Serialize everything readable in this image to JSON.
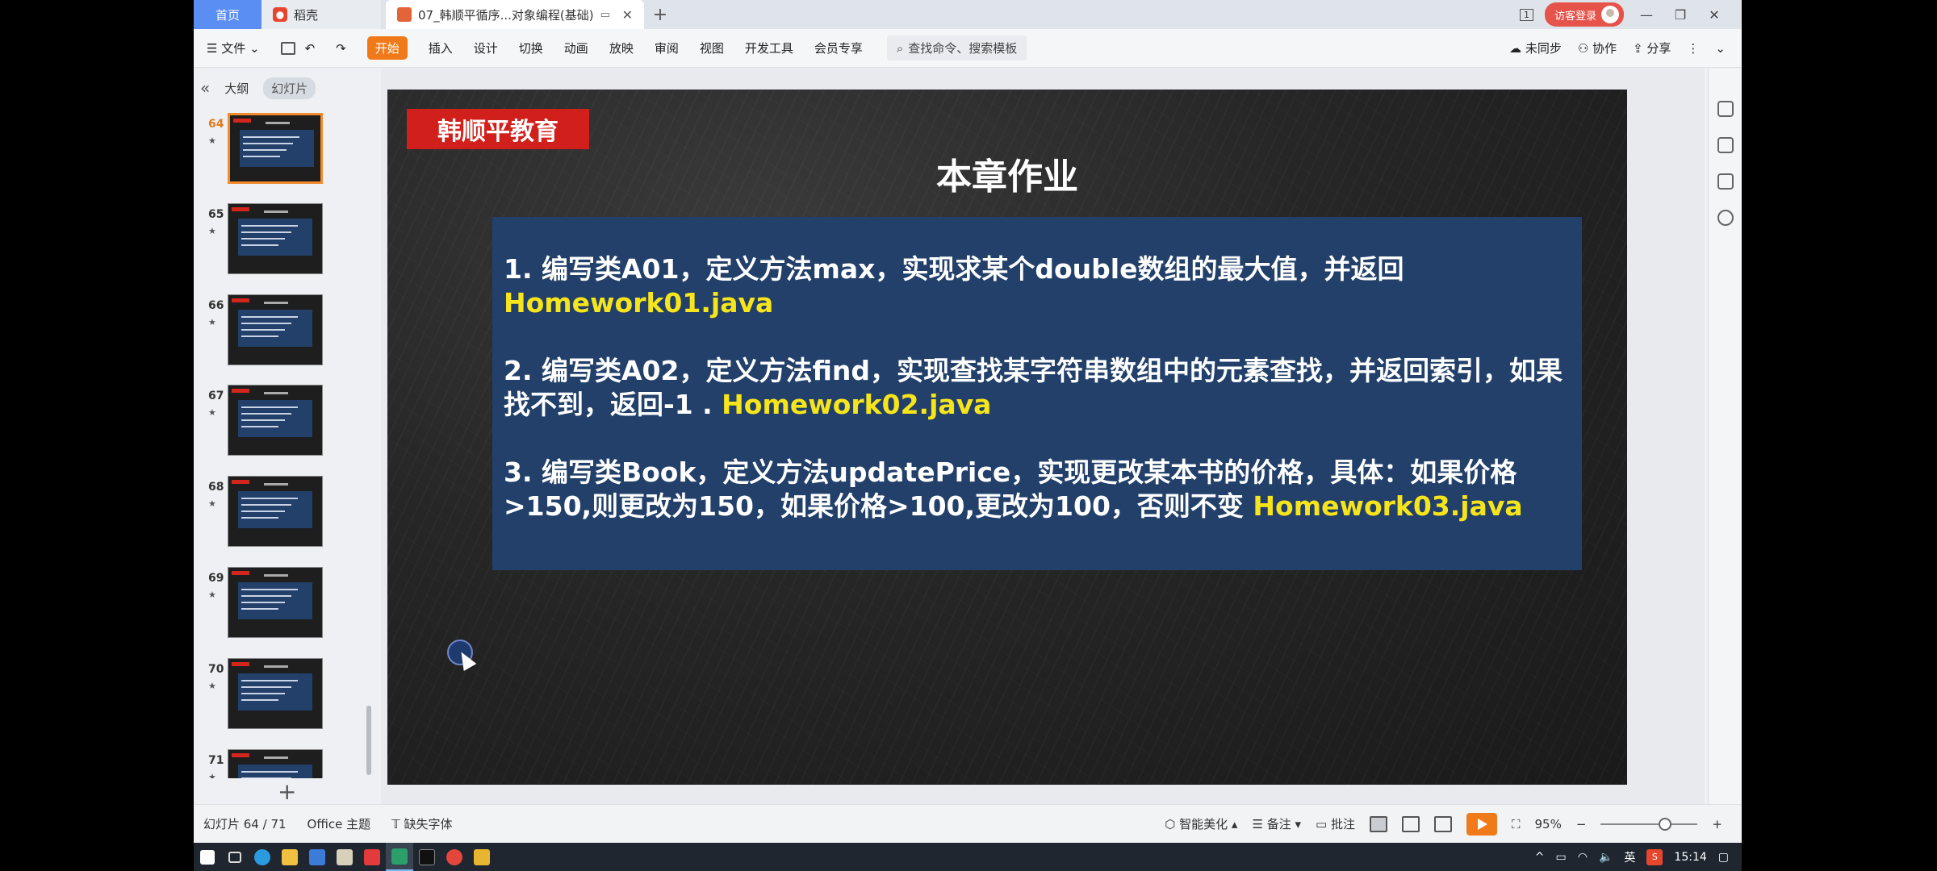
{
  "titlebar": {
    "home_tab": "首页",
    "wps_tab": "稻壳",
    "doc_tab": "07_韩顺平循序...对象编程(基础)",
    "login": "访客登录",
    "page_indicator": "1"
  },
  "menu": {
    "file": "文件",
    "start": "开始",
    "items": [
      "插入",
      "设计",
      "切换",
      "动画",
      "放映",
      "审阅",
      "视图",
      "开发工具",
      "会员专享"
    ],
    "search_placeholder": "查找命令、搜索模板",
    "unsynced": "未同步",
    "collab": "协作",
    "share": "分享"
  },
  "leftpanel": {
    "outline_tab": "大纲",
    "slides_tab": "幻灯片",
    "thumbnails": [
      {
        "num": "64",
        "active": true
      },
      {
        "num": "65",
        "active": false
      },
      {
        "num": "66",
        "active": false
      },
      {
        "num": "67",
        "active": false
      },
      {
        "num": "68",
        "active": false
      },
      {
        "num": "69",
        "active": false
      },
      {
        "num": "70",
        "active": false
      },
      {
        "num": "71",
        "active": false
      }
    ],
    "add_symbol": "+"
  },
  "slide": {
    "brand": "韩顺平教育",
    "title": "本章作业",
    "items": [
      {
        "text": "1. 编写类A01，定义方法max，实现求某个double数组的最大值，并返回 ",
        "file": "Homework01.java"
      },
      {
        "text": "2. 编写类A02，定义方法find，实现查找某字符串数组中的元素查找，并返回索引，如果找不到，返回-1 . ",
        "file": "Homework02.java"
      },
      {
        "text": "3. 编写类Book，定义方法updatePrice，实现更改某本书的价格，具体：如果价格>150,则更改为150，如果价格>100,更改为100，否则不变 ",
        "file": "Homework03.java"
      }
    ],
    "colors": {
      "box": "#22406a",
      "highlight": "#f7e51b",
      "brand_bg": "#d11f1b"
    }
  },
  "status": {
    "slide_count": "幻灯片 64 / 71",
    "theme": "Office 主题",
    "missing_font": "缺失字体",
    "beautify": "智能美化",
    "notes": "备注",
    "comments": "批注",
    "zoom": "95%"
  },
  "taskbar": {
    "time": "15:14",
    "ime": "英"
  }
}
